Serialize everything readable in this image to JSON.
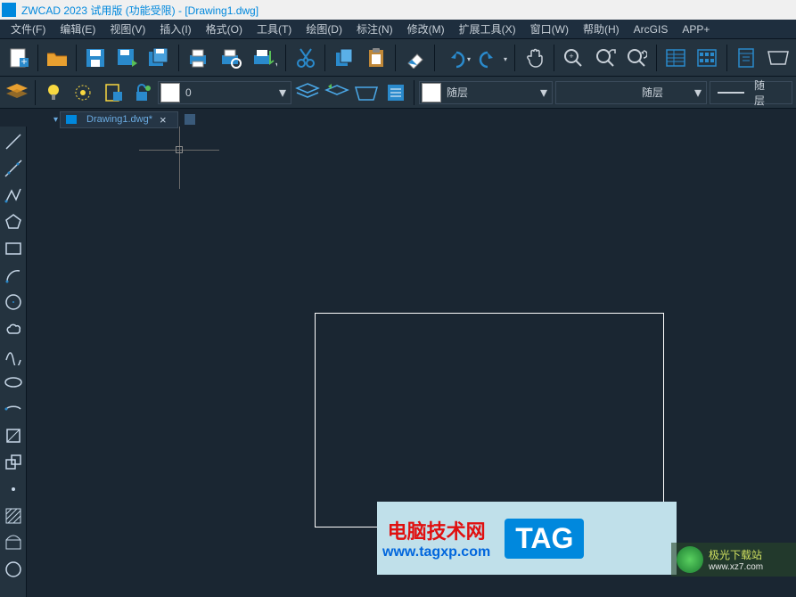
{
  "app": {
    "title": "ZWCAD 2023 试用版 (功能受限) - [Drawing1.dwg]"
  },
  "menu": {
    "file": "文件(F)",
    "edit": "编辑(E)",
    "view": "视图(V)",
    "insert": "插入(I)",
    "format": "格式(O)",
    "tools": "工具(T)",
    "draw": "绘图(D)",
    "dimension": "标注(N)",
    "modify": "修改(M)",
    "extend": "扩展工具(X)",
    "window": "窗口(W)",
    "help": "帮助(H)",
    "arcgis": "ArcGIS",
    "app": "APP+"
  },
  "layer": {
    "current": "0",
    "color_label": "随层",
    "linetype_label": "随层",
    "lineweight_label": "随层"
  },
  "tab": {
    "name": "Drawing1.dwg*"
  },
  "watermark": {
    "title": "电脑技术网",
    "url": "www.tagxp.com",
    "tag": "TAG"
  },
  "watermark2": {
    "title": "极光下载站",
    "url": "www.xz7.com"
  }
}
